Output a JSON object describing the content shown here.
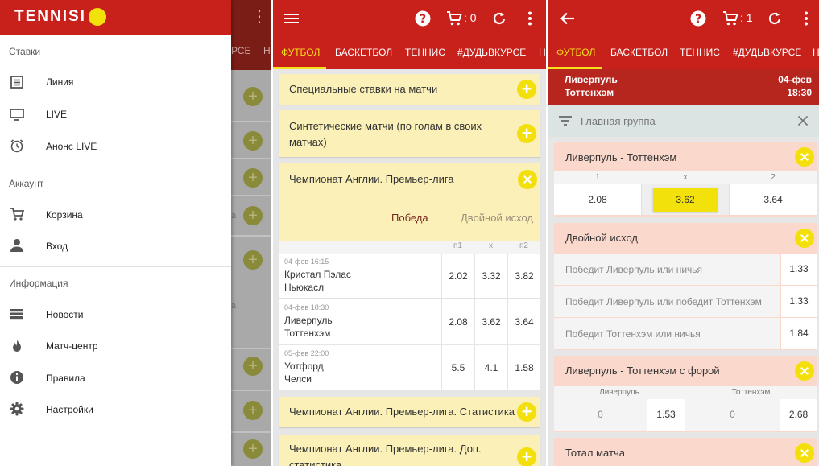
{
  "drawer": {
    "logo": "TENNISI",
    "sections": [
      {
        "label": "Ставки",
        "items": [
          {
            "label": "Линия",
            "icon": "list-icon"
          },
          {
            "label": "LIVE",
            "icon": "monitor-icon"
          },
          {
            "label": "Анонс LIVE",
            "icon": "alarm-clock-icon"
          }
        ]
      },
      {
        "label": "Аккаунт",
        "items": [
          {
            "label": "Корзина",
            "icon": "cart-icon"
          },
          {
            "label": "Вход",
            "icon": "person-icon"
          }
        ]
      },
      {
        "label": "Информация",
        "items": [
          {
            "label": "Новости",
            "icon": "news-icon"
          },
          {
            "label": "Матч-центр",
            "icon": "flame-icon"
          },
          {
            "label": "Правила",
            "icon": "info-icon"
          },
          {
            "label": "Настройки",
            "icon": "gear-icon"
          }
        ]
      }
    ],
    "behind": {
      "tab_partial": "РСЕ",
      "tab_partial2": "Н",
      "side_chars": [
        "а",
        "а"
      ]
    }
  },
  "screen2": {
    "cart_count": ": 0",
    "tabs": [
      "ФУТБОЛ",
      "БАСКЕТБОЛ",
      "ТЕННИС",
      "#ДУДЬВКУРСЕ",
      "Н"
    ],
    "cards": [
      {
        "title": "Специальные ставки на матчи"
      },
      {
        "title_line1": "Синтетические матчи (по голам в своих",
        "title_line2": "матчах)"
      },
      {
        "title": "Чемпионат Англии. Премьер-лига"
      }
    ],
    "subtabs": {
      "active": "Победа",
      "other": "Двойной исход"
    },
    "col_heads": [
      "п1",
      "х",
      "п2"
    ],
    "matches": [
      {
        "date": "04-фев 16:15",
        "home": "Кристал Пэлас",
        "away": "Ньюкасл",
        "odds": [
          "2.02",
          "3.32",
          "3.82"
        ]
      },
      {
        "date": "04-фев 18:30",
        "home": "Ливерпуль",
        "away": "Тоттенхэм",
        "odds": [
          "2.08",
          "3.62",
          "3.64"
        ]
      },
      {
        "date": "05-фев 22:00",
        "home": "Уотфорд",
        "away": "Челси",
        "odds": [
          "5.5",
          "4.1",
          "1.58"
        ]
      }
    ],
    "bottom_cards": [
      {
        "title": "Чемпионат Англии. Премьер-лига. Статистика"
      },
      {
        "title_line1": "Чемпионат Англии. Премьер-лига. Доп.",
        "title_line2": "статистика"
      }
    ]
  },
  "screen3": {
    "cart_count": ": 1",
    "tabs": [
      "ФУТБОЛ",
      "БАСКЕТБОЛ",
      "ТЕННИС",
      "#ДУДЬВКУРСЕ",
      "Н"
    ],
    "match": {
      "home": "Ливерпуль",
      "away": "Тоттенхэм",
      "date": "04-фев",
      "time": "18:30"
    },
    "group": "Главная группа",
    "main_market": {
      "title": "Ливерпуль - Тоттенхэм",
      "heads": [
        "1",
        "х",
        "2"
      ],
      "odds": [
        "2.08",
        "3.62",
        "3.64"
      ],
      "selected_color": "#f2e10b"
    },
    "double_chance": {
      "title": "Двойной исход",
      "rows": [
        {
          "label": "Победит Ливерпуль или ничья",
          "odd": "1.33"
        },
        {
          "label": "Победит Ливерпуль или победит Тоттенхэм",
          "odd": "1.33"
        },
        {
          "label": "Победит Тоттенхэм или ничья",
          "odd": "1.84"
        }
      ]
    },
    "handicap": {
      "title": "Ливерпуль - Тоттенхэм с форой",
      "heads": [
        "Ливерпуль",
        "Тоттенхэм"
      ],
      "values": [
        "0",
        "1.53",
        "0",
        "2.68"
      ]
    },
    "total": {
      "title": "Тотал матча"
    }
  },
  "colors": {
    "brand_red": "#c8201b",
    "accent_yellow": "#f2df0b",
    "tab_active": "#f6df1c"
  }
}
